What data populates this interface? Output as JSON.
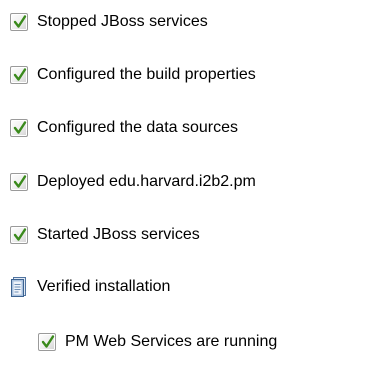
{
  "checklist": {
    "items": [
      {
        "label": "Stopped JBoss services",
        "icon": "checkbox-checked-icon",
        "checked": true
      },
      {
        "label": "Configured the build properties",
        "icon": "checkbox-checked-icon",
        "checked": true
      },
      {
        "label": "Configured the data sources",
        "icon": "checkbox-checked-icon",
        "checked": true
      },
      {
        "label": "Deployed edu.harvard.i2b2.pm",
        "icon": "checkbox-checked-icon",
        "checked": true
      },
      {
        "label": "Started JBoss services",
        "icon": "checkbox-checked-icon",
        "checked": true
      },
      {
        "label": "Verified installation",
        "icon": "document-clipboard-icon"
      },
      {
        "label": "PM Web Services are running",
        "icon": "checkbox-checked-icon",
        "checked": true
      }
    ]
  },
  "colors": {
    "text": "#000000",
    "check_mark": "#3a8a1c",
    "checkbox_border": "#9a9a9a",
    "document_icon": "#5a86b8"
  }
}
